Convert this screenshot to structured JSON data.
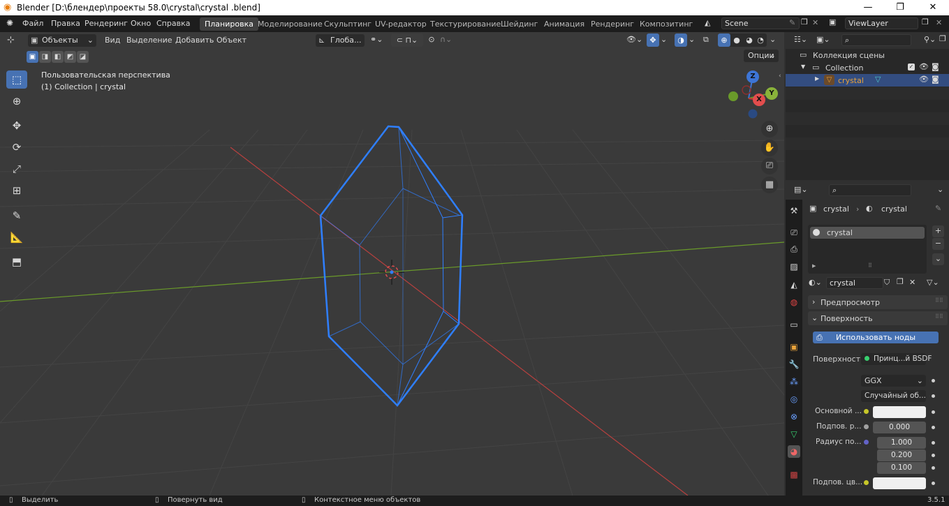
{
  "window": {
    "title": "Blender [D:\\блендер\\проекты 58.0\\crystal\\crystal .blend]",
    "minimize": "—",
    "maximize": "❐",
    "close": "✕"
  },
  "menu": {
    "file": "Файл",
    "edit": "Правка",
    "render": "Рендеринг",
    "window": "Окно",
    "help": "Справка"
  },
  "workspaces": [
    "Планировка",
    "Моделирование",
    "Скульптинг",
    "UV-редактор",
    "Текстурирование",
    "Шейдинг",
    "Анимация",
    "Рендеринг",
    "Композитинг"
  ],
  "scene": {
    "name": "Scene",
    "view_layer": "ViewLayer"
  },
  "viewport_header": {
    "mode": "Объекты",
    "view": "Вид",
    "select": "Выделение",
    "add": "Добавить",
    "object": "Объект",
    "orientation": "Глоба...",
    "options": "Опции"
  },
  "viewport": {
    "perspective": "Пользовательская перспектива",
    "collection_info": "(1) Collection | crystal"
  },
  "gizmo": {
    "z": "Z",
    "y": "Y",
    "x": "X"
  },
  "outliner": {
    "scene_collection": "Коллекция сцены",
    "collection": "Collection",
    "object": "crystal"
  },
  "properties": {
    "breadcrumb_object": "crystal",
    "breadcrumb_material": "crystal",
    "slot": "crystal",
    "material_name": "crystal",
    "preview": "Предпросмотр",
    "surface_section": "Поверхность",
    "use_nodes": "Использовать ноды",
    "surface_label": "Поверхность",
    "surface_value": "Принц...й BSDF",
    "distribution": "GGX",
    "subsurface_method": "Случайный об...",
    "base_color": "Основной ...",
    "subsurface_label": "Подпов. р...",
    "subsurface_value": "0.000",
    "radius_label": "Радиус по...",
    "radius_x": "1.000",
    "radius_y": "0.200",
    "radius_z": "0.100",
    "subsurface_color": "Подпов. цв..."
  },
  "status": {
    "select": "Выделить",
    "rotate": "Повернуть вид",
    "context": "Контекстное меню объектов",
    "version": "3.5.1"
  },
  "colors": {
    "accent": "#4772b3",
    "selection": "#2f7fff",
    "x_axis": "#b8403f",
    "y_axis": "#6a9a2a",
    "active_object": "#e8a23a"
  }
}
